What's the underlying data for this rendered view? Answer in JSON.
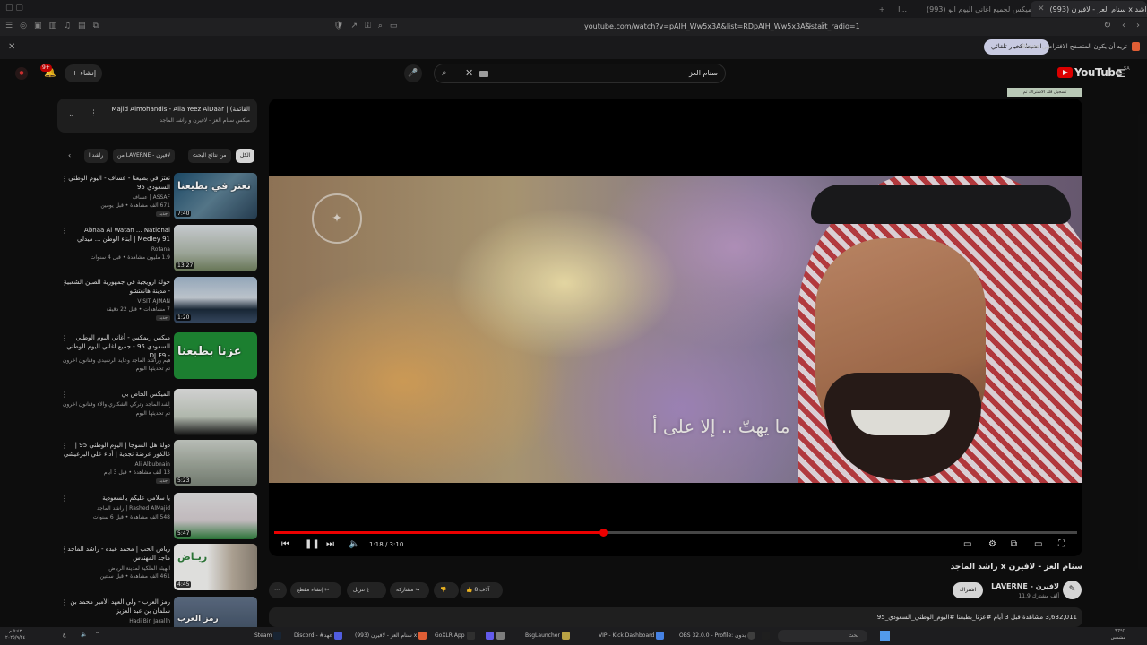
{
  "browser": {
    "tabs": [
      {
        "label": "(993) سنام العز - لافيرن x راشد",
        "active": true
      },
      {
        "label": "(993) ماش - ميكس لجميع اغاني اليوم الو",
        "active": false
      },
      {
        "label": "ا...",
        "active": false
      }
    ],
    "url": "youtube.com/watch?v=pAlH_Ww5x3A&list=RDpAlH_Ww5x3A&start_radio=1",
    "notification": {
      "message": "Brave تريد أن يكون المتصفح الافتراضي",
      "button": "الضبط كخيار تلقائي"
    }
  },
  "header": {
    "create_label": "إنشاء",
    "notification_count": "9+",
    "search_query": "سنام العز",
    "logo_text": "YouTube",
    "logo_region": "SA"
  },
  "playlist": {
    "title": "Majid Almohandis - Alla Yeez AlDaar | (القائمة",
    "subtitle": "ميكس سنام العز - لافيرن و راشد الماجد"
  },
  "chips": [
    "الكل",
    "من نتائج البحث",
    "من LAVERNE - لافيرن",
    "راشد ا"
  ],
  "related": [
    {
      "title": "نعتز في بطيعنا - عساف - اليوم الوطني السعودي 95",
      "channel": "عساف | ASSAF",
      "meta": "671 ألف مشاهدة • قبل يومين",
      "badge": "جديد",
      "duration": "7:40",
      "thumb_text": "نعتز في بطيعنا"
    },
    {
      "title": "Abnaa Al Watan ... National Medley 91 | أبناء الوطن ... ميدلي وطني",
      "channel": "Rotana",
      "meta": "1.9 مليون مشاهدة • قبل 4 سنوات",
      "badge": "",
      "duration": "13:27",
      "thumb_text": ""
    },
    {
      "title": "جولة ارويجية في جمهورية الصين الشعبية - مدينة هانغتشو",
      "channel": "VISIT AJMAN",
      "meta": "7 مشاهدات • قبل 22 دقيقة",
      "badge": "جديد",
      "duration": "1:20",
      "thumb_text": ""
    },
    {
      "title": "ميكس ريمكس - أغاني اليوم الوطني السعودي 95 - جميع اغاني اليوم الوطني - DJ E9",
      "channel": "عساف، إبراهيم وراشد الماجد وعايد الرشيدي وفنانون آخرون",
      "meta": "تم تحديثها اليوم",
      "badge": "",
      "duration": "",
      "thumb_text": "عزنا بطبعنا"
    },
    {
      "title": "الميكس الخاص بي",
      "channel": "راشد الماجد وتركي الشكاري والاء وفنانون آخرون",
      "meta": "تم تحديثها اليوم",
      "badge": "",
      "duration": "",
      "thumb_text": ""
    },
    {
      "title": "دولة هل السوجا | اليوم الوطني 95 | غالكور عرضة نجدية | أداء علي البرعيشي",
      "channel": "Ali Albubnain",
      "meta": "13 ألف مشاهدة • قبل 3 أيام",
      "badge": "جديد",
      "duration": "5:23",
      "thumb_text": ""
    },
    {
      "title": "يا سلامي عليكم يالسعودية",
      "channel": "راشد الماجد | Rashed AlMajid",
      "meta": "548 ألف مشاهدة • قبل 6 سنوات",
      "badge": "",
      "duration": "5:47",
      "thumb_text": ""
    },
    {
      "title": "رياض الحب | محمد عبده - راشد الماجد - ماجد المهندس",
      "channel": "الهيئة الملكية لمدينة الرياض",
      "meta": "461 ألف مشاهدة • قبل سنتين",
      "badge": "",
      "duration": "4:45",
      "thumb_text": "ريـاض"
    },
    {
      "title": "رمز العرب - ولي العهد الأمير محمد بن سلمان بن عبد العزيز",
      "channel": "Hadi Bin Jarallh",
      "meta": "",
      "badge": "",
      "duration": "",
      "thumb_text": "رمز العرب"
    }
  ],
  "player": {
    "ad_tag": "تسجيل فك الاشتراك تم",
    "caption": "ما يهتّ .. إلا على أ",
    "current_time": "1:18",
    "duration": "3:10",
    "progress": 0.41
  },
  "video": {
    "title": "سنام العز - لافيرن x راشد الماجد",
    "channel": "LAVERNE - لافيرن",
    "subscribers": "11.9 ألف مشترك",
    "subscribe_label": "اشتراك",
    "like_count": "8 آلاف",
    "share_label": "مشاركة",
    "download_label": "تنزيل",
    "clip_label": "إنشاء مقطع",
    "views_line": "3,632,011 مشاهدة قبل 3 أيام #عزنا_بطبعنا #اليوم_الوطني_السعودي_95"
  },
  "taskbar": {
    "time": "٥:٤٢ م",
    "date": "٢٠٢٥/٩/٢٤",
    "weather": "37°C",
    "weather_desc": "مشمس",
    "search_label": "بحث",
    "apps": [
      "Steam",
      "Discord - #عهد",
      "(993) سنام العز - لافيرن x",
      "GoXLR App",
      "BsgLauncher",
      "VIP - Kick Dashboard",
      "OBS 32.0.0 - Profile: بدون"
    ]
  },
  "colors": {
    "accent": "#ff0000",
    "background": "#0f0f0f"
  }
}
